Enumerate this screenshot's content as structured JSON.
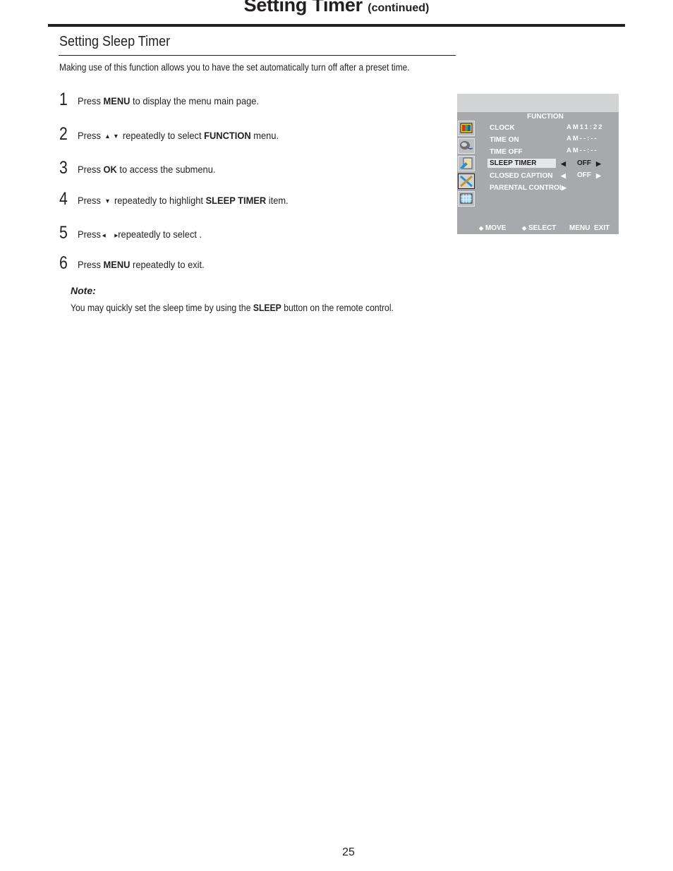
{
  "header": {
    "title": "Setting Timer",
    "subtitle": "(continued)"
  },
  "section": {
    "title": "Setting Sleep Timer",
    "intro": "Making use of this function allows you to have the set automatically turn off after a preset time."
  },
  "steps": [
    {
      "number": "1",
      "pre": "Press ",
      "bold": "MENU",
      "post": " to display the menu main page."
    },
    {
      "number": "2",
      "pre": "Press",
      "icons": [
        "up-arrow-icon",
        "down-arrow-icon"
      ],
      "mid": " repeatedly to select ",
      "bold": "FUNCTION",
      "post": " menu."
    },
    {
      "number": "3",
      "pre": "Press ",
      "bold": "OK",
      "post": " to access the submenu."
    },
    {
      "number": "4",
      "pre": "Press",
      "icons": [
        "down-arrow-icon"
      ],
      "mid": " repeatedly to highlight ",
      "bold": "SLEEP TIMER",
      "post": " item."
    },
    {
      "number": "5",
      "pre": "Press",
      "icons": [
        "left-arrow-icon",
        "right-arrow-icon"
      ],
      "post": "repeatedly to select ."
    },
    {
      "number": "6",
      "pre": "Press ",
      "bold": "MENU",
      "post": " repeatedly to exit."
    }
  ],
  "glyphs": {
    "up": "▲",
    "down": "▼",
    "left": "◀",
    "right": "▶",
    "diamond": "◆"
  },
  "note": {
    "label": "Note:",
    "pre": "You may quickly set the sleep time by using the ",
    "bold": "SLEEP",
    "post": " button on the remote control."
  },
  "osd": {
    "menu_title": "FUNCTION",
    "tabs": [
      {
        "icon": "picture-icon"
      },
      {
        "icon": "sound-icon"
      },
      {
        "icon": "channel-icon"
      },
      {
        "icon": "function-icon",
        "selected": true
      },
      {
        "icon": "grid-icon"
      }
    ],
    "items": [
      {
        "label": "CLOCK",
        "value": "AM11:22"
      },
      {
        "label": "TIME ON",
        "value": "AM--:--"
      },
      {
        "label": "TIME OFF",
        "value": "AM--:--"
      },
      {
        "label": "SLEEP TIMER",
        "option": "OFF",
        "highlighted": true
      },
      {
        "label": "CLOSED CAPTION",
        "option": "OFF"
      },
      {
        "label": "PARENTAL CONTROL",
        "submenu": true
      }
    ],
    "footer": {
      "move": "MOVE",
      "select": "SELECT",
      "menu": "MENU",
      "exit": "EXIT"
    }
  },
  "page_number": "25"
}
